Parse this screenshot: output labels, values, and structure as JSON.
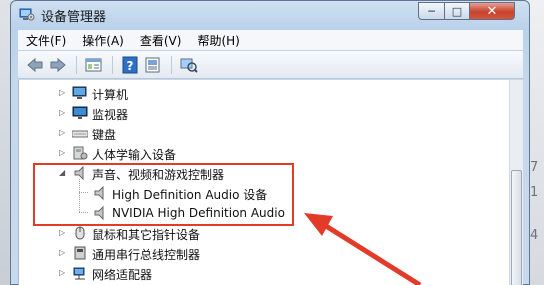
{
  "window": {
    "title": "设备管理器",
    "controls": {
      "minimize": "─",
      "maximize": "□",
      "close": "✕"
    }
  },
  "menu": [
    "文件(F)",
    "操作(A)",
    "查看(V)",
    "帮助(H)"
  ],
  "toolbar": {
    "buttons": [
      "back-icon",
      "forward-icon",
      "properties-icon",
      "help-icon",
      "driver-icon",
      "scan-icon"
    ]
  },
  "tree": {
    "items": [
      {
        "label": "计算机",
        "icon": "computer-icon",
        "expanded": false
      },
      {
        "label": "监视器",
        "icon": "monitor-icon",
        "expanded": false
      },
      {
        "label": "键盘",
        "icon": "keyboard-icon",
        "expanded": false
      },
      {
        "label": "人体学输入设备",
        "icon": "hid-icon",
        "expanded": false
      },
      {
        "label": "声音、视频和游戏控制器",
        "icon": "speaker-icon",
        "expanded": true,
        "children": [
          {
            "label": "High Definition Audio 设备",
            "icon": "speaker-icon"
          },
          {
            "label": "NVIDIA High Definition Audio",
            "icon": "speaker-icon"
          }
        ]
      },
      {
        "label": "鼠标和其它指针设备",
        "icon": "mouse-icon",
        "expanded": false
      },
      {
        "label": "通用串行总线控制器",
        "icon": "usb-icon",
        "expanded": false
      },
      {
        "label": "网络适配器",
        "icon": "network-icon",
        "expanded": false
      }
    ]
  },
  "annotation": {
    "highlight_color": "#e23b2a"
  },
  "background": {
    "right_chars": [
      "7",
      "1",
      "4"
    ]
  }
}
